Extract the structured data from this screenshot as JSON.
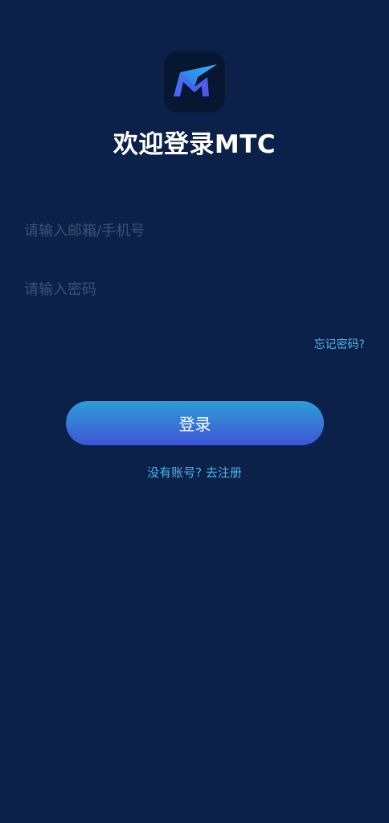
{
  "app": {
    "title": "欢迎登录MTC",
    "logo_icon": "mtc-logo-icon"
  },
  "form": {
    "email_placeholder": "请输入邮箱/手机号",
    "email_value": "",
    "password_placeholder": "请输入密码",
    "password_value": "",
    "forgot_label": "忘记密码?",
    "login_label": "登录",
    "register_label": "没有账号? 去注册"
  },
  "colors": {
    "background": "#0b214a",
    "accent": "#4fb4ea",
    "button_gradient_top": "#2d9ed6",
    "button_gradient_bottom": "#4054d6"
  }
}
